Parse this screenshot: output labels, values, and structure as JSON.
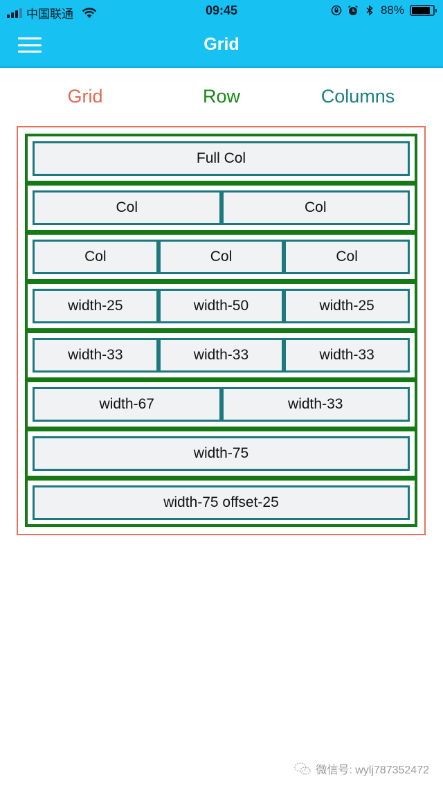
{
  "status_bar": {
    "carrier": "中国联通",
    "time": "09:45",
    "battery_percent_text": "88%",
    "battery_level": 0.88,
    "icons": [
      "signal-icon",
      "wifi-icon",
      "orientation-lock-icon",
      "alarm-icon",
      "bluetooth-icon",
      "battery-icon"
    ]
  },
  "navbar": {
    "title": "Grid",
    "menu_icon": "hamburger-menu-icon"
  },
  "legend": {
    "grid": "Grid",
    "row": "Row",
    "columns": "Columns"
  },
  "colors": {
    "navbar_bg": "#17c1f1",
    "grid": "#e5725c",
    "row": "#157a15",
    "column": "#1c7a7f",
    "column_bg": "#f1f2f4"
  },
  "rows": [
    {
      "cols": [
        {
          "label": "Full Col"
        }
      ]
    },
    {
      "cols": [
        {
          "label": "Col"
        },
        {
          "label": "Col"
        }
      ]
    },
    {
      "cols": [
        {
          "label": "Col"
        },
        {
          "label": "Col"
        },
        {
          "label": "Col"
        }
      ]
    },
    {
      "cols": [
        {
          "label": "width-25"
        },
        {
          "label": "width-50"
        },
        {
          "label": "width-25"
        }
      ]
    },
    {
      "cols": [
        {
          "label": "width-33"
        },
        {
          "label": "width-33"
        },
        {
          "label": "width-33"
        }
      ]
    },
    {
      "cols": [
        {
          "label": "width-67"
        },
        {
          "label": "width-33"
        }
      ]
    },
    {
      "cols": [
        {
          "label": "width-75"
        }
      ]
    },
    {
      "cols": [
        {
          "label": "width-75 offset-25"
        }
      ]
    }
  ],
  "watermark": {
    "text": "微信号: wylj787352472"
  }
}
